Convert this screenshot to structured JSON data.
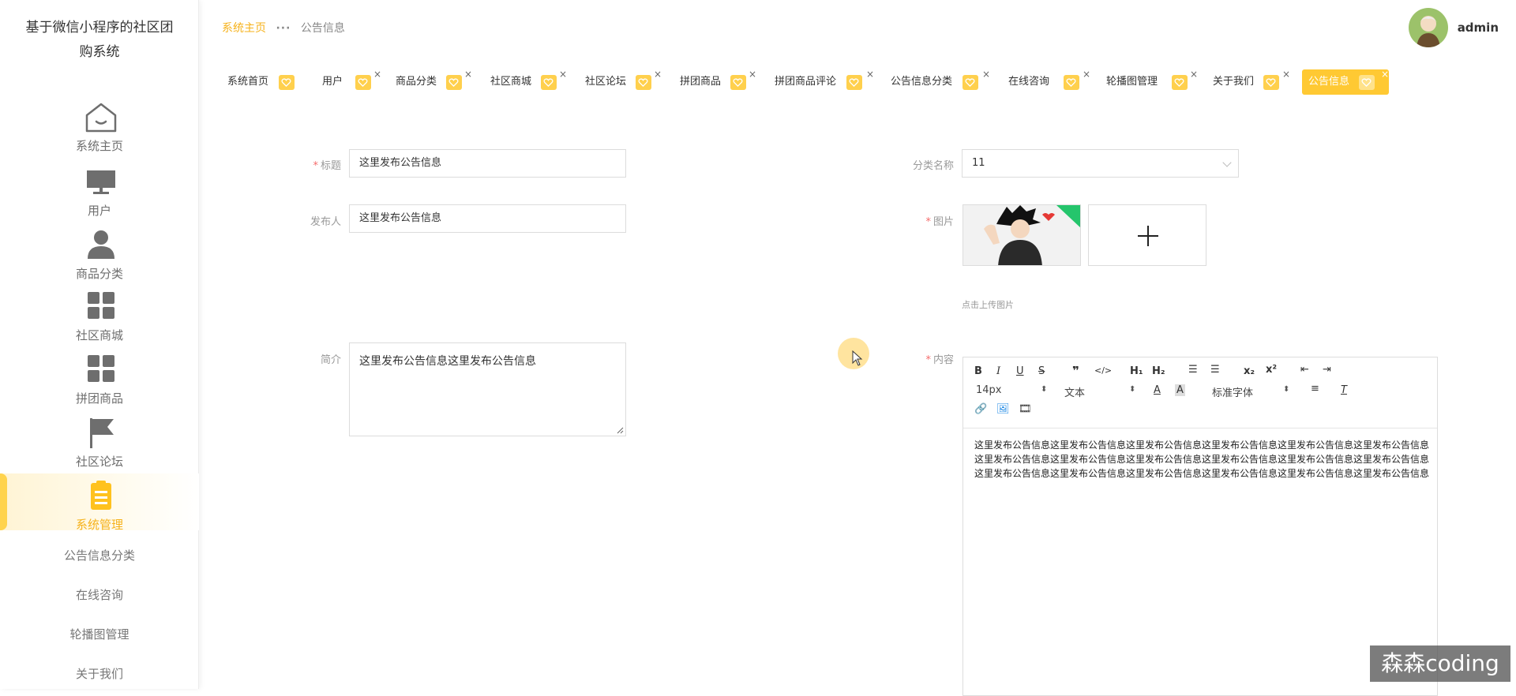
{
  "app": {
    "title_line1": "基于微信小程序的社区团",
    "title_line2": "购系统"
  },
  "sidebar": {
    "items": [
      {
        "label": "系统主页",
        "icon": "home-icon"
      },
      {
        "label": "用户",
        "icon": "monitor-icon"
      },
      {
        "label": "商品分类",
        "icon": "person-icon"
      },
      {
        "label": "社区商城",
        "icon": "grid-icon"
      },
      {
        "label": "拼团商品",
        "icon": "grid-icon"
      },
      {
        "label": "社区论坛",
        "icon": "flag-icon"
      },
      {
        "label": "系统管理",
        "icon": "clipboard-icon"
      }
    ],
    "sub_items": [
      "公告信息分类",
      "在线咨询",
      "轮播图管理",
      "关于我们"
    ]
  },
  "breadcrumb": {
    "home": "系统主页",
    "current": "公告信息"
  },
  "user": {
    "name": "admin"
  },
  "tags": [
    "系统首页",
    "用户",
    "商品分类",
    "社区商城",
    "社区论坛",
    "拼团商品",
    "拼团商品评论",
    "公告信息分类",
    "在线咨询",
    "轮播图管理",
    "关于我们",
    "公告信息"
  ],
  "tag_close": "×",
  "form": {
    "title_label": "标题",
    "title_value": "这里发布公告信息",
    "category_label": "分类名称",
    "category_value": "11",
    "publisher_label": "发布人",
    "publisher_value": "这里发布公告信息",
    "image_label": "图片",
    "upload_hint": "点击上传图片",
    "summary_label": "简介",
    "summary_value": "这里发布公告信息这里发布公告信息",
    "content_label": "内容",
    "required_mark": "*"
  },
  "editor": {
    "font_size": "14px",
    "text_type": "文本",
    "font_family": "标准字体",
    "content": "这里发布公告信息这里发布公告信息这里发布公告信息这里发布公告信息这里发布公告信息这里发布公告信息这里发布公告信息这里发布公告信息这里发布公告信息这里发布公告信息这里发布公告信息这里发布公告信息这里发布公告信息这里发布公告信息这里发布公告信息这里发布公告信息这里发布公告信息这里发布公告信息"
  },
  "watermark": "森森coding",
  "colors": {
    "accent": "#f6b21b",
    "tag": "#ffd04d",
    "required": "#f56c6c"
  }
}
